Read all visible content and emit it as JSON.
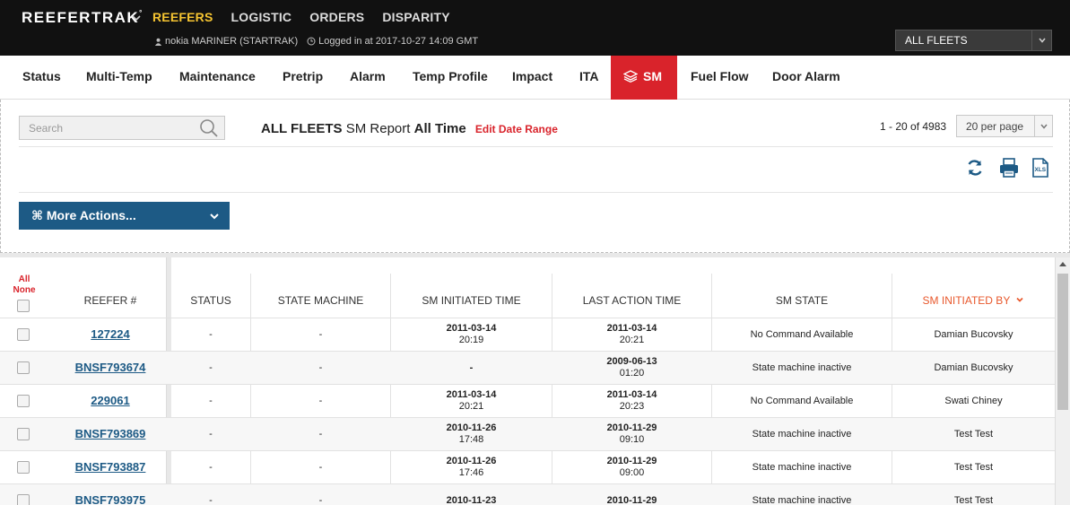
{
  "header": {
    "brand": "REEFERTRAK",
    "brand_mark": "°",
    "nav": [
      {
        "label": "REEFERS",
        "active": true
      },
      {
        "label": "LOGISTIC",
        "active": false
      },
      {
        "label": "ORDERS",
        "active": false
      },
      {
        "label": "DISPARITY",
        "active": false
      }
    ],
    "user": "nokia MARINER (STARTRAK)",
    "login": "Logged in at 2017-10-27 14:09 GMT",
    "fleet_select": "ALL FLEETS"
  },
  "tabs": [
    {
      "label": "Status",
      "active": false
    },
    {
      "label": "Multi-Temp",
      "active": false
    },
    {
      "label": "Maintenance",
      "active": false
    },
    {
      "label": "Pretrip",
      "active": false
    },
    {
      "label": "Alarm",
      "active": false
    },
    {
      "label": "Temp Profile",
      "active": false
    },
    {
      "label": "Impact",
      "active": false
    },
    {
      "label": "ITA",
      "active": false
    },
    {
      "label": "SM",
      "active": true
    },
    {
      "label": "Fuel Flow",
      "active": false
    },
    {
      "label": "Door Alarm",
      "active": false
    }
  ],
  "report": {
    "search_placeholder": "Search",
    "title_fleet": "ALL FLEETS",
    "title_mid": "SM Report",
    "title_range": "All Time",
    "edit_range": "Edit Date Range",
    "pager": "1 - 20 of 4983",
    "per_page": "20 per page",
    "more_actions": "⌘ More Actions..."
  },
  "table": {
    "all": "All",
    "none": "None",
    "columns": [
      "REEFER #",
      "STATUS",
      "STATE MACHINE",
      "SM INITIATED TIME",
      "LAST ACTION TIME",
      "SM STATE",
      "SM INITIATED BY"
    ],
    "rows": [
      {
        "reefer": "127224",
        "status": "-",
        "state_machine": "-",
        "init_date": "2011-03-14",
        "init_time": "20:19",
        "last_date": "2011-03-14",
        "last_time": "20:21",
        "sm_state": "No Command Available",
        "by": "Damian Bucovsky"
      },
      {
        "reefer": "BNSF793674",
        "status": "-",
        "state_machine": "-",
        "init_date": "-",
        "init_time": "",
        "last_date": "2009-06-13",
        "last_time": "01:20",
        "sm_state": "State machine inactive",
        "by": "Damian Bucovsky"
      },
      {
        "reefer": "229061",
        "status": "-",
        "state_machine": "-",
        "init_date": "2011-03-14",
        "init_time": "20:21",
        "last_date": "2011-03-14",
        "last_time": "20:23",
        "sm_state": "No Command Available",
        "by": "Swati Chiney"
      },
      {
        "reefer": "BNSF793869",
        "status": "-",
        "state_machine": "-",
        "init_date": "2010-11-26",
        "init_time": "17:48",
        "last_date": "2010-11-29",
        "last_time": "09:10",
        "sm_state": "State machine inactive",
        "by": "Test Test"
      },
      {
        "reefer": "BNSF793887",
        "status": "-",
        "state_machine": "-",
        "init_date": "2010-11-26",
        "init_time": "17:46",
        "last_date": "2010-11-29",
        "last_time": "09:00",
        "sm_state": "State machine inactive",
        "by": "Test Test"
      },
      {
        "reefer": "BNSF793975",
        "status": "-",
        "state_machine": "-",
        "init_date": "2010-11-23",
        "init_time": "",
        "last_date": "2010-11-29",
        "last_time": "",
        "sm_state": "State machine inactive",
        "by": "Test Test"
      }
    ]
  },
  "colors": {
    "accent_red": "#d9232b",
    "nav_active": "#f5c431",
    "link_blue": "#1d5a85",
    "sort_orange": "#e8582c"
  }
}
